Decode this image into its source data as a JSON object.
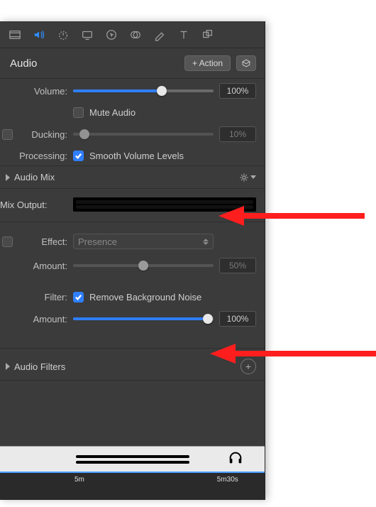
{
  "header": {
    "title": "Audio",
    "action_label": "+ Action"
  },
  "volume": {
    "label": "Volume:",
    "value": "100%",
    "fill_pct": 63
  },
  "mute": {
    "label": "Mute Audio",
    "checked": false
  },
  "ducking": {
    "label": "Ducking:",
    "checked": false,
    "value": "10%",
    "thumb_pct": 8
  },
  "processing": {
    "label": "Processing:",
    "checked": true,
    "option": "Smooth Volume Levels"
  },
  "audiomix": {
    "title": "Audio Mix"
  },
  "mixoutput": {
    "label": "Mix Output:"
  },
  "effect": {
    "label": "Effect:",
    "checked": false,
    "selected": "Presence"
  },
  "effect_amount": {
    "label": "Amount:",
    "value": "50%",
    "thumb_pct": 50
  },
  "filter": {
    "label": "Filter:",
    "checked": true,
    "option": "Remove Background Noise"
  },
  "filter_amount": {
    "label": "Amount:",
    "value": "100%",
    "fill_pct": 96
  },
  "audiofilters": {
    "title": "Audio Filters"
  },
  "timeline": {
    "t1": "5m",
    "t2": "5m30s"
  }
}
